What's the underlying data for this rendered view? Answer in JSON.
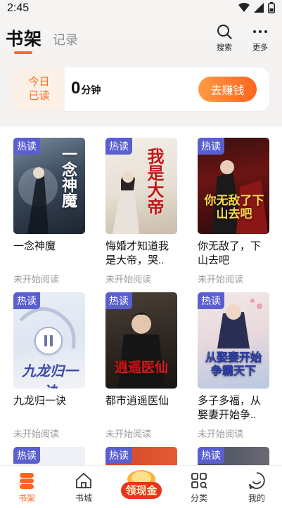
{
  "status_bar": {
    "time": "2:45"
  },
  "header": {
    "tab_shelf": "书架",
    "tab_records": "记录",
    "search_label": "搜索",
    "more_label": "更多"
  },
  "reading": {
    "today_label": "今日已读",
    "minutes_value": "0",
    "minutes_unit": "分钟",
    "earn_button": "去赚钱"
  },
  "books": [
    {
      "title": "一念神魔",
      "status": "未开始阅读",
      "badge": "热读",
      "cover_text": "一念神魔"
    },
    {
      "title": "悔婚才知道我是大帝，哭..",
      "status": "未开始阅读",
      "badge": "热读",
      "cover_text": "我是大帝"
    },
    {
      "title": "你无敌了，下山去吧",
      "status": "未开始阅读",
      "badge": "热读",
      "cover_text": "你无敌了下山去吧"
    },
    {
      "title": "九龙归一诀",
      "status": "未开始阅读",
      "badge": "热读",
      "cover_text": "九龙归一诀"
    },
    {
      "title": "都市逍遥医仙",
      "status": "未开始阅读",
      "badge": "热读",
      "cover_text": "逍遥医仙"
    },
    {
      "title": "多子多福，从娶妻开始争..",
      "status": "未开始阅读",
      "badge": "热读",
      "cover_text": "从娶妻开始争霸天下"
    },
    {
      "badge": "热读"
    },
    {
      "badge": "热读"
    },
    {
      "badge": "热读"
    }
  ],
  "bottom_nav": {
    "shelf": "书架",
    "store": "书城",
    "cash": "领现金",
    "category": "分类",
    "mine": "我的"
  },
  "colors": {
    "accent": "#ff6420",
    "badge": "#5a5fcf"
  }
}
